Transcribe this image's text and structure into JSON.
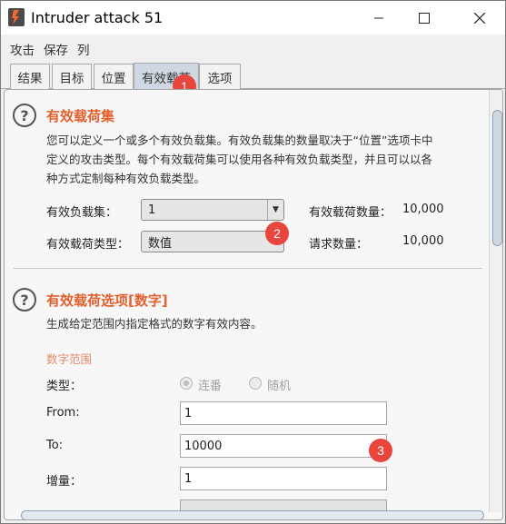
{
  "window": {
    "title": "Intruder attack 51"
  },
  "menu": [
    "攻击",
    "保存",
    "列"
  ],
  "tabs": [
    {
      "label": "结果",
      "active": false
    },
    {
      "label": "目标",
      "active": false
    },
    {
      "label": "位置",
      "active": false
    },
    {
      "label": "有效载荷",
      "active": true
    },
    {
      "label": "选项",
      "active": false
    }
  ],
  "payload_sets": {
    "title": "有效载荷集",
    "description_lines": [
      "您可以定义一个或多个有效负载集。有效负载集的数量取决于“位置”选项卡中",
      "定义的攻击类型。每个有效载荷集可以使用各种有效负载类型，并且可以以各",
      "种方式定制每种有效负载类型。"
    ],
    "set_label": "有效负载集：",
    "set_value": "1",
    "type_label": "有效载荷类型：",
    "type_value": "数值",
    "count_label": "有效载荷数量：",
    "count_value": "10,000",
    "requests_label": "请求数量：",
    "requests_value": "10,000"
  },
  "payload_options": {
    "title": "有效载荷选项[数字]",
    "description": "生成给定范围内指定格式的数字有效内容。",
    "range_heading": "数字范围",
    "type_label": "类型：",
    "radio_sequential": "连番",
    "radio_random": "随机",
    "selected_type": "连番",
    "from_label": "From:",
    "from_value": "1",
    "to_label": "To:",
    "to_value": "10000",
    "step_label": "增量：",
    "step_value": "1"
  },
  "badges": [
    "1",
    "2",
    "3"
  ],
  "colors": {
    "section_title": "#e2612f",
    "badge": "#e8453c",
    "active_tab": "#cfd8e2"
  },
  "icons": [
    "burp-app-icon",
    "minimize-icon",
    "maximize-icon",
    "close-icon",
    "help-icon",
    "dropdown-arrow-icon"
  ]
}
